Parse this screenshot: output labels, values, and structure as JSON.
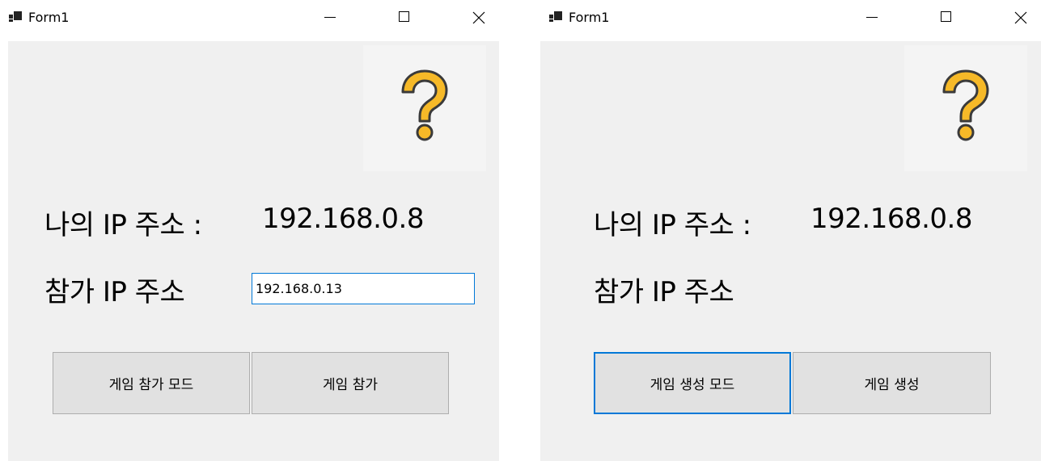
{
  "windows": [
    {
      "title": "Form1",
      "my_ip_label": "나의 IP 주소 :",
      "my_ip_value": "192.168.0.8",
      "join_ip_label": "참가 IP 주소",
      "join_ip_input_value": "192.168.0.13",
      "buttons": [
        "게임 참가 모드",
        "게임 참가"
      ]
    },
    {
      "title": "Form1",
      "my_ip_label": "나의 IP 주소 :",
      "my_ip_value": "192.168.0.8",
      "join_ip_label": "참가 IP 주소",
      "buttons": [
        "게임 생성 모드",
        "게임 생성"
      ]
    }
  ],
  "icons": {
    "app": "form-app-icon",
    "minimize": "minimize-icon",
    "maximize": "maximize-icon",
    "close": "close-icon",
    "help": "question-mark-icon"
  },
  "colors": {
    "client_bg": "#f0f0f0",
    "focus_accent": "#0078d7",
    "help_icon_fill": "#f6b928"
  }
}
